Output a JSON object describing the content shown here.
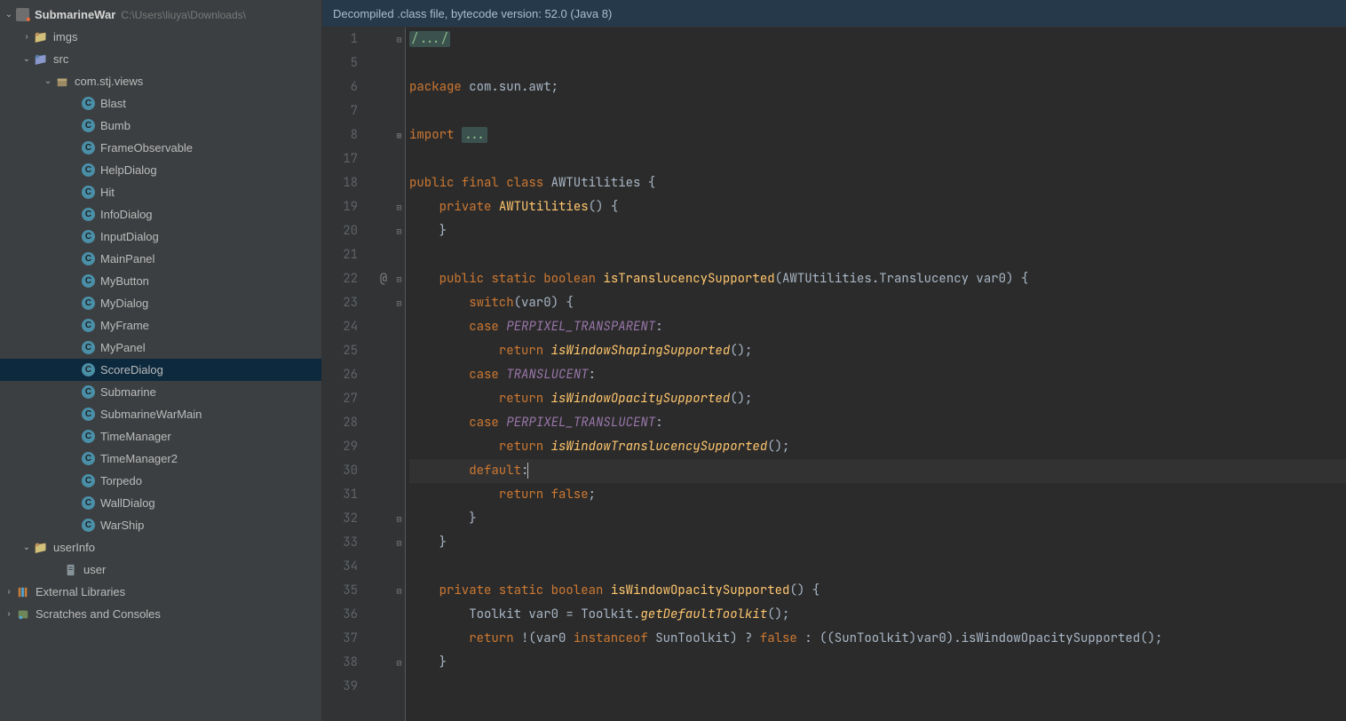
{
  "project": {
    "name": "SubmarineWar",
    "path": "C:\\Users\\liuya\\Downloads\\"
  },
  "tree": {
    "imgs": "imgs",
    "src": "src",
    "pkg": "com.stj.views",
    "classes": [
      "Blast",
      "Bumb",
      "FrameObservable",
      "HelpDialog",
      "Hit",
      "InfoDialog",
      "InputDialog",
      "MainPanel",
      "MyButton",
      "MyDialog",
      "MyFrame",
      "MyPanel",
      "ScoreDialog",
      "Submarine",
      "SubmarineWarMain",
      "TimeManager",
      "TimeManager2",
      "Torpedo",
      "WallDialog",
      "WarShip"
    ],
    "userInfo": "userInfo",
    "user": "user",
    "external": "External Libraries",
    "scratches": "Scratches and Consoles"
  },
  "notification": "Decompiled .class file, bytecode version: 52.0 (Java 8)",
  "lineNumbers": [
    "1",
    "5",
    "6",
    "7",
    "8",
    "17",
    "18",
    "19",
    "20",
    "21",
    "22",
    "23",
    "24",
    "25",
    "26",
    "27",
    "28",
    "29",
    "30",
    "31",
    "32",
    "33",
    "34",
    "35",
    "36",
    "37",
    "38",
    "39"
  ],
  "gutterMarks": [
    "",
    "",
    "",
    "",
    "",
    "",
    "",
    "",
    "",
    "",
    "@",
    "",
    "",
    "",
    "",
    "",
    "",
    "",
    "",
    "",
    "",
    "",
    "",
    "",
    "",
    "",
    "",
    ""
  ],
  "foldMarks": [
    "⊟",
    "",
    "",
    "",
    "⊞",
    "",
    "",
    "⊟",
    "⊟",
    "",
    "⊟",
    "⊟",
    "",
    "",
    "",
    "",
    "",
    "",
    "",
    "",
    "⊟",
    "⊟",
    "",
    "⊟",
    "",
    "",
    "⊟",
    ""
  ],
  "code": {
    "l0_fold": "/.../",
    "l2_kw": "package",
    "l2_pkg": " com.sun.awt",
    "l4_kw": "import",
    "l4_fold": "...",
    "l6_a": "public final class",
    "l6_b": " AWTUtilities {",
    "l7_a": "private",
    "l7_b": "AWTUtilities",
    "l7_c": "() {",
    "l8": "}",
    "l10_a": "public static boolean",
    "l10_b": "isTranslucencySupported",
    "l10_c": "(AWTUtilities.Translucency var0) {",
    "l11_a": "switch",
    "l11_b": "(var0) {",
    "l12_a": "case",
    "l12_b": "PERPIXEL_TRANSPARENT",
    "l13_a": "return",
    "l13_b": "isWindowShapingSupported",
    "l14_b": "TRANSLUCENT",
    "l15_b": "isWindowOpacitySupported",
    "l16_b": "PERPIXEL_TRANSLUCENT",
    "l17_b": "isWindowTranslucencySupported",
    "l18_a": "default",
    "l19_a": "return false",
    "l20": "}",
    "l21": "}",
    "l23_a": "private static boolean",
    "l23_b": "isWindowOpacitySupported",
    "l23_c": "() {",
    "l24_a": "Toolkit var0 = Toolkit.",
    "l24_b": "getDefaultToolkit",
    "l25_a": "return",
    "l25_b": " !(var0 ",
    "l25_c": "instanceof",
    "l25_d": " SunToolkit) ? ",
    "l25_e": "false",
    "l25_f": " : ((SunToolkit)var0).isWindowOpacitySupported();",
    "l26": "}"
  }
}
